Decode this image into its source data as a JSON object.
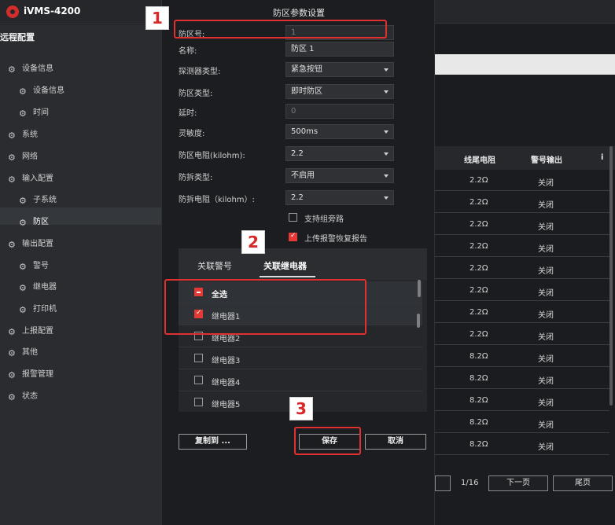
{
  "app": {
    "title": "iVMS-4200"
  },
  "sidebar": {
    "header": "远程配置",
    "items": [
      {
        "label": "设备信息",
        "level": 1
      },
      {
        "label": "设备信息",
        "level": 2
      },
      {
        "label": "时间",
        "level": 2
      },
      {
        "label": "系统",
        "level": 1
      },
      {
        "label": "网络",
        "level": 1
      },
      {
        "label": "输入配置",
        "level": 1
      },
      {
        "label": "子系统",
        "level": 2
      },
      {
        "label": "防区",
        "level": 2,
        "selected": true
      },
      {
        "label": "输出配置",
        "level": 1
      },
      {
        "label": "警号",
        "level": 2
      },
      {
        "label": "继电器",
        "level": 2
      },
      {
        "label": "打印机",
        "level": 2
      },
      {
        "label": "上报配置",
        "level": 1
      },
      {
        "label": "其他",
        "level": 1
      },
      {
        "label": "报警管理",
        "level": 1
      },
      {
        "label": "状态",
        "level": 1
      }
    ]
  },
  "table": {
    "headers": [
      "线尾电阻",
      "警号输出",
      "i"
    ],
    "rows": [
      [
        "2.2Ω",
        "关闭"
      ],
      [
        "2.2Ω",
        "关闭"
      ],
      [
        "2.2Ω",
        "关闭"
      ],
      [
        "2.2Ω",
        "关闭"
      ],
      [
        "2.2Ω",
        "关闭"
      ],
      [
        "2.2Ω",
        "关闭"
      ],
      [
        "2.2Ω",
        "关闭"
      ],
      [
        "2.2Ω",
        "关闭"
      ],
      [
        "8.2Ω",
        "关闭"
      ],
      [
        "8.2Ω",
        "关闭"
      ],
      [
        "8.2Ω",
        "关闭"
      ],
      [
        "8.2Ω",
        "关闭"
      ],
      [
        "8.2Ω",
        "关闭"
      ]
    ]
  },
  "pager": {
    "page_text": "1/16",
    "next": "下一页",
    "last": "尾页"
  },
  "dialog": {
    "title": "防区参数设置",
    "fields": [
      {
        "label": "防区号:",
        "value": "1",
        "type": "disabled"
      },
      {
        "label": "名称:",
        "value": "防区 1",
        "type": "text"
      },
      {
        "label": "探测器类型:",
        "value": "紧急按钮",
        "type": "select"
      },
      {
        "label": "防区类型:",
        "value": "即时防区",
        "type": "select"
      },
      {
        "label": "延时:",
        "value": "0",
        "type": "disabled"
      },
      {
        "label": "灵敏度:",
        "value": "500ms",
        "type": "select"
      },
      {
        "label": "防区电阻(kilohm):",
        "value": "2.2",
        "type": "select"
      },
      {
        "label": "防拆类型:",
        "value": "不启用",
        "type": "select"
      },
      {
        "label": "防拆电阻（kilohm）:",
        "value": "2.2",
        "type": "select"
      }
    ],
    "options": [
      {
        "label": "支持组旁路",
        "checked": false
      },
      {
        "label": "上传报警恢复报告",
        "checked": true
      }
    ],
    "tabs": [
      {
        "label": "关联警号",
        "active": false
      },
      {
        "label": "关联继电器",
        "active": true
      }
    ],
    "relay_list": [
      {
        "label": "全选",
        "state": "partial"
      },
      {
        "label": "继电器1",
        "state": "checked"
      },
      {
        "label": "继电器2",
        "state": "unchecked"
      },
      {
        "label": "继电器3",
        "state": "unchecked"
      },
      {
        "label": "继电器4",
        "state": "unchecked"
      },
      {
        "label": "继电器5",
        "state": "unchecked"
      }
    ],
    "buttons": {
      "copy": "复制到 ...",
      "save": "保存",
      "cancel": "取消"
    }
  },
  "annotations": [
    "1",
    "2",
    "3"
  ],
  "colors": {
    "accent": "#e53935",
    "annotation": "#e0302f"
  }
}
